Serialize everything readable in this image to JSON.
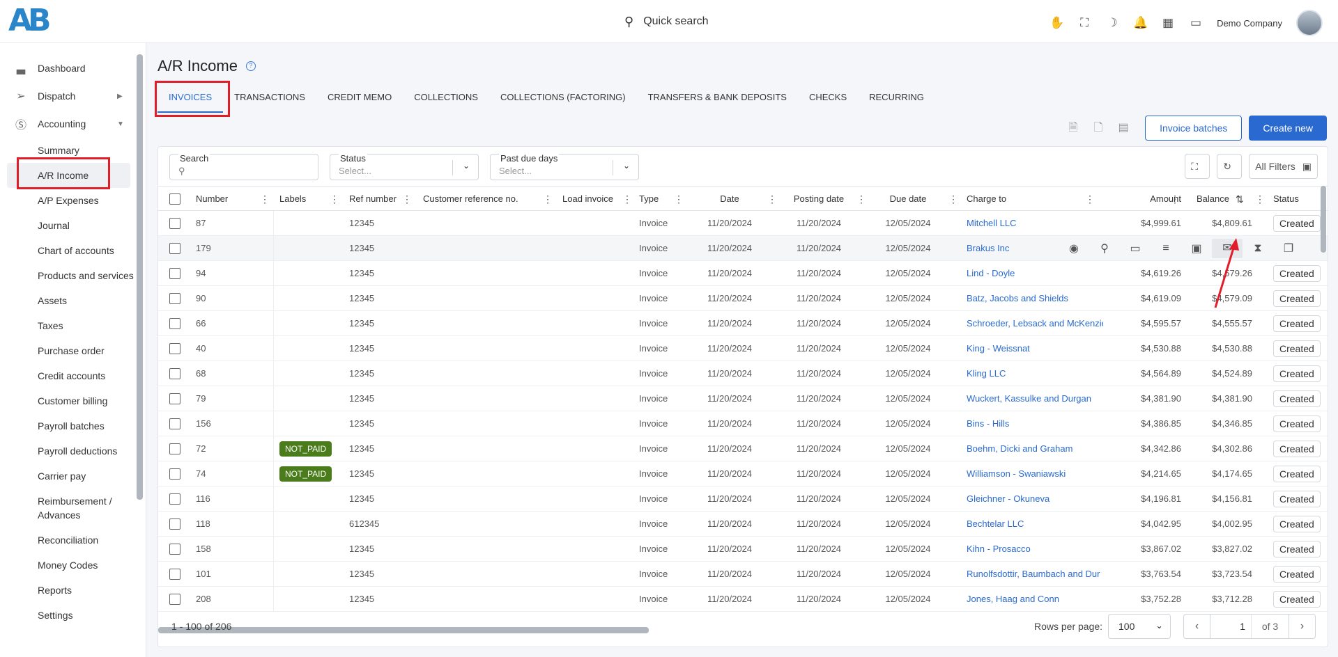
{
  "topbar": {
    "logo_text": "AB",
    "search_placeholder": "Quick search",
    "company": "Demo Company"
  },
  "sidebar": {
    "items": [
      {
        "label": "Dashboard",
        "icon": "chart-icon"
      },
      {
        "label": "Dispatch",
        "icon": "send-icon"
      },
      {
        "label": "Accounting",
        "icon": "dollar-icon"
      }
    ],
    "accounting_sub": [
      "Summary",
      "A/R Income",
      "A/P Expenses",
      "Journal",
      "Chart of accounts",
      "Products and services",
      "Assets",
      "Taxes",
      "Purchase order",
      "Credit accounts",
      "Customer billing",
      "Payroll batches",
      "Payroll deductions",
      "Carrier pay",
      "Reimbursement / Advances",
      "Reconciliation",
      "Money Codes",
      "Reports",
      "Settings"
    ]
  },
  "page": {
    "title": "A/R Income",
    "tabs": [
      "INVOICES",
      "TRANSACTIONS",
      "CREDIT MEMO",
      "COLLECTIONS",
      "COLLECTIONS (FACTORING)",
      "TRANSFERS & BANK DEPOSITS",
      "CHECKS",
      "RECURRING"
    ],
    "invoice_batches": "Invoice batches",
    "create_new": "Create new"
  },
  "filters": {
    "search_label": "Search",
    "status_label": "Status",
    "status_placeholder": "Select...",
    "pastdue_label": "Past due days",
    "pastdue_placeholder": "Select...",
    "all_filters": "All Filters"
  },
  "table": {
    "headers": {
      "number": "Number",
      "labels": "Labels",
      "ref": "Ref number",
      "custref": "Customer reference no.",
      "load": "Load invoice",
      "type": "Type",
      "date": "Date",
      "posting": "Posting date",
      "due": "Due date",
      "charge": "Charge to",
      "amount": "Amount",
      "balance": "Balance",
      "status": "Status"
    },
    "rows": [
      {
        "number": "87",
        "label": "",
        "ref": "12345",
        "type": "Invoice",
        "date": "11/20/2024",
        "posting": "11/20/2024",
        "due": "12/05/2024",
        "charge": "Mitchell LLC",
        "amount": "$4,999.61",
        "balance": "$4,809.61",
        "status": "Created"
      },
      {
        "number": "179",
        "label": "",
        "ref": "12345",
        "type": "Invoice",
        "date": "11/20/2024",
        "posting": "11/20/2024",
        "due": "12/05/2024",
        "charge": "Brakus Inc",
        "amount": "",
        "balance": "",
        "status": ""
      },
      {
        "number": "94",
        "label": "",
        "ref": "12345",
        "type": "Invoice",
        "date": "11/20/2024",
        "posting": "11/20/2024",
        "due": "12/05/2024",
        "charge": "Lind - Doyle",
        "amount": "$4,619.26",
        "balance": "$4,579.26",
        "status": "Created"
      },
      {
        "number": "90",
        "label": "",
        "ref": "12345",
        "type": "Invoice",
        "date": "11/20/2024",
        "posting": "11/20/2024",
        "due": "12/05/2024",
        "charge": "Batz, Jacobs and Shields",
        "amount": "$4,619.09",
        "balance": "$4,579.09",
        "status": "Created"
      },
      {
        "number": "66",
        "label": "",
        "ref": "12345",
        "type": "Invoice",
        "date": "11/20/2024",
        "posting": "11/20/2024",
        "due": "12/05/2024",
        "charge": "Schroeder, Lebsack and McKenzie",
        "amount": "$4,595.57",
        "balance": "$4,555.57",
        "status": "Created"
      },
      {
        "number": "40",
        "label": "",
        "ref": "12345",
        "type": "Invoice",
        "date": "11/20/2024",
        "posting": "11/20/2024",
        "due": "12/05/2024",
        "charge": "King - Weissnat",
        "amount": "$4,530.88",
        "balance": "$4,530.88",
        "status": "Created"
      },
      {
        "number": "68",
        "label": "",
        "ref": "12345",
        "type": "Invoice",
        "date": "11/20/2024",
        "posting": "11/20/2024",
        "due": "12/05/2024",
        "charge": "Kling LLC",
        "amount": "$4,564.89",
        "balance": "$4,524.89",
        "status": "Created"
      },
      {
        "number": "79",
        "label": "",
        "ref": "12345",
        "type": "Invoice",
        "date": "11/20/2024",
        "posting": "11/20/2024",
        "due": "12/05/2024",
        "charge": "Wuckert, Kassulke and Durgan",
        "amount": "$4,381.90",
        "balance": "$4,381.90",
        "status": "Created"
      },
      {
        "number": "156",
        "label": "",
        "ref": "12345",
        "type": "Invoice",
        "date": "11/20/2024",
        "posting": "11/20/2024",
        "due": "12/05/2024",
        "charge": "Bins - Hills",
        "amount": "$4,386.85",
        "balance": "$4,346.85",
        "status": "Created"
      },
      {
        "number": "72",
        "label": "NOT_PAID",
        "ref": "12345",
        "type": "Invoice",
        "date": "11/20/2024",
        "posting": "11/20/2024",
        "due": "12/05/2024",
        "charge": "Boehm, Dicki and Graham",
        "amount": "$4,342.86",
        "balance": "$4,302.86",
        "status": "Created"
      },
      {
        "number": "74",
        "label": "NOT_PAID",
        "ref": "12345",
        "type": "Invoice",
        "date": "11/20/2024",
        "posting": "11/20/2024",
        "due": "12/05/2024",
        "charge": "Williamson - Swaniawski",
        "amount": "$4,214.65",
        "balance": "$4,174.65",
        "status": "Created"
      },
      {
        "number": "116",
        "label": "",
        "ref": "12345",
        "type": "Invoice",
        "date": "11/20/2024",
        "posting": "11/20/2024",
        "due": "12/05/2024",
        "charge": "Gleichner - Okuneva",
        "amount": "$4,196.81",
        "balance": "$4,156.81",
        "status": "Created"
      },
      {
        "number": "118",
        "label": "",
        "ref": "612345",
        "type": "Invoice",
        "date": "11/20/2024",
        "posting": "11/20/2024",
        "due": "12/05/2024",
        "charge": "Bechtelar LLC",
        "amount": "$4,042.95",
        "balance": "$4,002.95",
        "status": "Created"
      },
      {
        "number": "158",
        "label": "",
        "ref": "12345",
        "type": "Invoice",
        "date": "11/20/2024",
        "posting": "11/20/2024",
        "due": "12/05/2024",
        "charge": "Kihn - Prosacco",
        "amount": "$3,867.02",
        "balance": "$3,827.02",
        "status": "Created"
      },
      {
        "number": "101",
        "label": "",
        "ref": "12345",
        "type": "Invoice",
        "date": "11/20/2024",
        "posting": "11/20/2024",
        "due": "12/05/2024",
        "charge": "Runolfsdottir, Baumbach and Dur",
        "amount": "$3,763.54",
        "balance": "$3,723.54",
        "status": "Created"
      },
      {
        "number": "208",
        "label": "",
        "ref": "12345",
        "type": "Invoice",
        "date": "11/20/2024",
        "posting": "11/20/2024",
        "due": "12/05/2024",
        "charge": "Jones, Haag and Conn",
        "amount": "$3,752.28",
        "balance": "$3,712.28",
        "status": "Created"
      }
    ]
  },
  "footer": {
    "range": "1 - 100 of 206",
    "rows_per_page_label": "Rows per page:",
    "rows_per_page": "100",
    "page": "1",
    "of": "of 3"
  }
}
